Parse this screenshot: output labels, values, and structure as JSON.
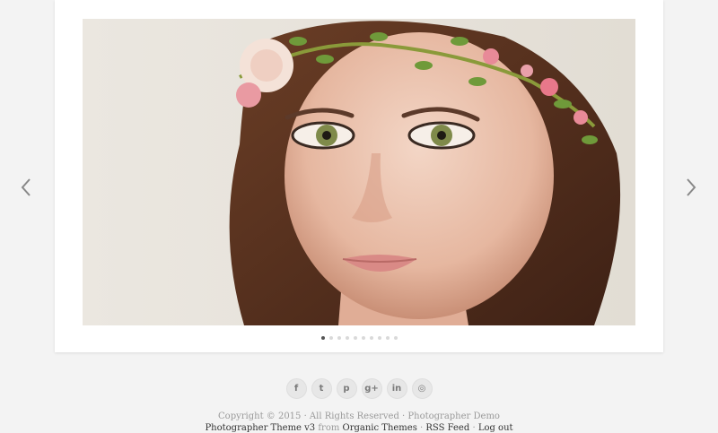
{
  "slideshow": {
    "prev_icon": "chevron-left-icon",
    "next_icon": "chevron-right-icon",
    "slide_count": 10,
    "active_index": 0
  },
  "social": [
    {
      "icon": "facebook-icon",
      "glyph": "f"
    },
    {
      "icon": "twitter-icon",
      "glyph": "t"
    },
    {
      "icon": "pinterest-icon",
      "glyph": "p"
    },
    {
      "icon": "google-plus-icon",
      "glyph": "g+"
    },
    {
      "icon": "linkedin-icon",
      "glyph": "in"
    },
    {
      "icon": "dribbble-icon",
      "glyph": "◎"
    }
  ],
  "footer": {
    "copyright": "Copyright © 2015 · All Rights Reserved · Photographer Demo",
    "theme_link": "Photographer Theme v3",
    "from_text": " from ",
    "organic_link": "Organic Themes",
    "sep1": " · ",
    "rss_link": "RSS Feed",
    "sep2": " · ",
    "logout_link": "Log out"
  },
  "colors": {
    "background": "#f3f3f3",
    "card": "#ffffff",
    "dot_active": "#555555",
    "dot_inactive": "#d9d9d9"
  }
}
